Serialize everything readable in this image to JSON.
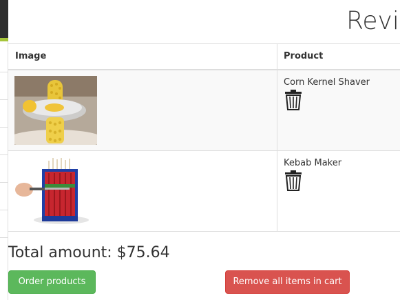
{
  "page": {
    "title": "Review"
  },
  "table": {
    "headers": {
      "image": "Image",
      "product": "Product"
    },
    "rows": [
      {
        "product": "Corn Kernel Shaver",
        "image_alt": "corn kernel shaver photo"
      },
      {
        "product": "Kebab Maker",
        "image_alt": "kebab maker photo"
      }
    ]
  },
  "summary": {
    "total": "Total amount: $75.64"
  },
  "actions": {
    "order_label": "Order products",
    "remove_all_label": "Remove all items in cart"
  },
  "colors": {
    "sidebar_dark": "#2d2d2d",
    "sidebar_accent": "#a6c53a",
    "success": "#5cb85c",
    "danger": "#d9534f"
  },
  "icons": {
    "delete": "trash-icon"
  }
}
